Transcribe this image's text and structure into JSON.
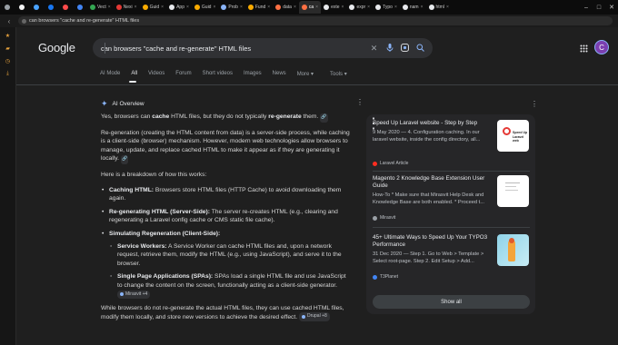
{
  "browser": {
    "tabs": [
      {
        "label": "",
        "color": "#9aa0a6",
        "pinned": true
      },
      {
        "label": "",
        "color": "#f5f5f5",
        "pinned": true
      },
      {
        "label": "",
        "color": "#4aa3ff",
        "pinned": true
      },
      {
        "label": "",
        "color": "#1877f2",
        "pinned": true
      },
      {
        "label": "",
        "color": "#ff4b4b",
        "pinned": true
      },
      {
        "label": "",
        "color": "#4285f4",
        "pinned": true
      },
      {
        "label": "Vect",
        "color": "#34a853"
      },
      {
        "label": "Nexi",
        "color": "#e53935"
      },
      {
        "label": "Guid",
        "color": "#f9ab00"
      },
      {
        "label": "App",
        "color": "#e8eaed"
      },
      {
        "label": "Guid",
        "color": "#f9ab00"
      },
      {
        "label": "Prob",
        "color": "#8ab4f8"
      },
      {
        "label": "Fund",
        "color": "#f9ab00"
      },
      {
        "label": "data",
        "color": "#ff7043"
      },
      {
        "label": "ca",
        "color": "#ff7043",
        "active": true
      },
      {
        "label": "exte",
        "color": "#e8eaed"
      },
      {
        "label": "expr",
        "color": "#e8eaed"
      },
      {
        "label": "Typo",
        "color": "#e8eaed"
      },
      {
        "label": "nam",
        "color": "#e8eaed"
      },
      {
        "label": "html",
        "color": "#e8eaed"
      }
    ],
    "url": "can browsers \"cache and re-generate\" HTML files"
  },
  "google": {
    "logo": "Google",
    "query": "can browsers \"cache and re-generate\" HTML files",
    "avatar_letter": "C",
    "nav": [
      "AI Mode",
      "All",
      "Videos",
      "Forum",
      "Short videos",
      "Images",
      "News",
      "More",
      "Tools"
    ]
  },
  "ai_overview": {
    "heading": "AI Overview",
    "p1_a": "Yes, browsers can ",
    "p1_b": "cache",
    "p1_c": " HTML files, but they do not typically ",
    "p1_d": "re-generate",
    "p1_e": " them.",
    "p2": "Re-generation (creating the HTML content from data) is a server-side process, while caching is a client-side (browser) mechanism. However, modern web technologies allow browsers to manage, update, and replace cached HTML to make it appear as if they are generating it locally.",
    "p3": "Here is a breakdown of how this works:",
    "b1_title": "Caching HTML:",
    "b1_text": " Browsers store HTML files (HTTP Cache) to avoid downloading them again.",
    "b2_title": "Re-generating HTML (Server-Side):",
    "b2_text": " The server re-creates HTML (e.g., clearing and regenerating a Laravel config cache or CMS static file cache).",
    "b3_title": "Simulating Regeneration (Client-Side):",
    "s1_title": "Service Workers:",
    "s1_text": " A Service Worker can cache HTML files and, upon a network request, retrieve them, modify the HTML (e.g., using JavaScript), and serve it to the browser.",
    "s2_title": "Single Page Applications (SPAs):",
    "s2_text": " SPAs load a single HTML file and use JavaScript to change the content on the screen, functionally acting as a client-side generator.",
    "s2_chip": "Mirasvit +4",
    "p4": "While browsers do not re-generate the actual HTML files, they can use cached HTML files, modify them locally, and store new versions to achieve the desired",
    "p4_end": "effect.",
    "p4_chip": "Drupal +8"
  },
  "sources": [
    {
      "title": "Speed Up Laravel website - Step by Step",
      "snippet": "9 May 2020 — 4. Configuration caching. In our laravel website, inside the config directory, all...",
      "source": "Laravel Article",
      "fav": "#ff2d20"
    },
    {
      "title": "Magento 2 Knowledge Base Extension User Guide",
      "snippet": "How-To * Make sure that Mirasvit Help Desk and Knowledge Base are both enabled. * Proceed t...",
      "source": "Mirasvit",
      "fav": "#9aa0a6"
    },
    {
      "title": "45+ Ultimate Ways to Speed Up Your TYPO3 Performance",
      "snippet": "31 Dec 2020 — Step 1. Go to Web > Template > Select root-page. Step 2. Edit Setup > Add...",
      "source": "T3Planet",
      "fav": "#4285f4"
    }
  ],
  "thumb1_text": "Speed Up Laravel web",
  "show_all": "Show all"
}
